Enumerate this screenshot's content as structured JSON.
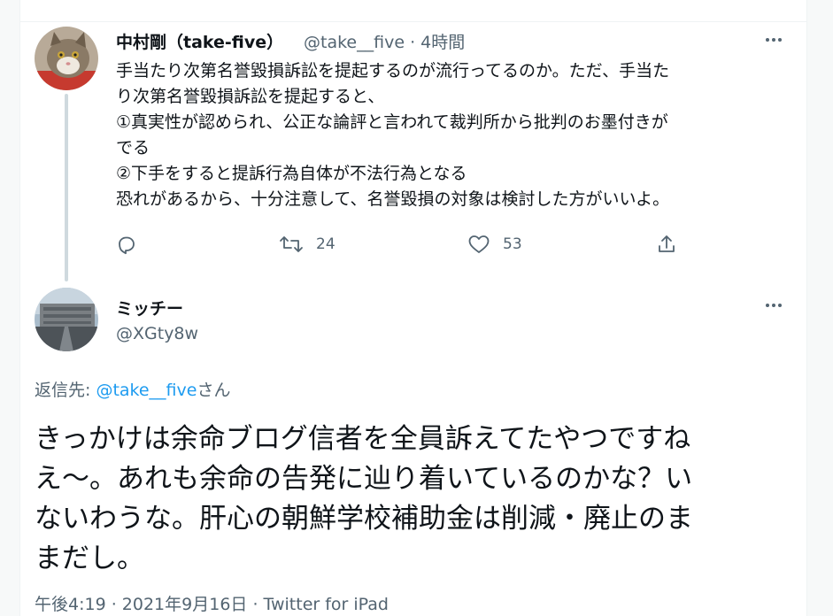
{
  "original_tweet": {
    "author_name": "中村剛（take-five）",
    "author_handle": "@take__five",
    "separator": "·",
    "time": "4時間",
    "avatar": "cat-avatar",
    "text": "手当たり次第名誉毀損訴訟を提起するのが流行ってるのか。ただ、手当た\nり次第名誉毀損訴訟を提起すると、\n①真実性が認められ、公正な論評と言われて裁判所から批判のお墨付きが\nでる\n②下手をすると提訴行為自体が不法行為となる\n恐れがあるから、十分注意して、名誉毀損の対象は検討した方がいいよ。",
    "actions": {
      "reply_icon": "reply-icon",
      "retweet_icon": "retweet-icon",
      "retweet_count": "24",
      "like_icon": "heart-icon",
      "like_count": "53",
      "share_icon": "share-icon"
    }
  },
  "reply_tweet": {
    "author_name": "ミッチー",
    "author_handle": "@XGty8w",
    "avatar": "building-photo-avatar",
    "reply_to_prefix": "返信先: ",
    "reply_to_handle": "@take__five",
    "reply_to_suffix": "さん",
    "text": "きっかけは余命ブログ信者を全員訴えてたやつですね\nえ〜。あれも余命の告発に辿り着いているのかな？い\nないわうな。肝心の朝鮮学校補助金は削減・廃止のま\nまだし。",
    "timestamp": "午後4:19 · 2021年9月16日 · Twitter for iPad"
  },
  "colors": {
    "link": "#1d9bf0",
    "secondary_text": "#536471",
    "primary_text": "#0f1419",
    "thread_line": "#cfd9de"
  }
}
